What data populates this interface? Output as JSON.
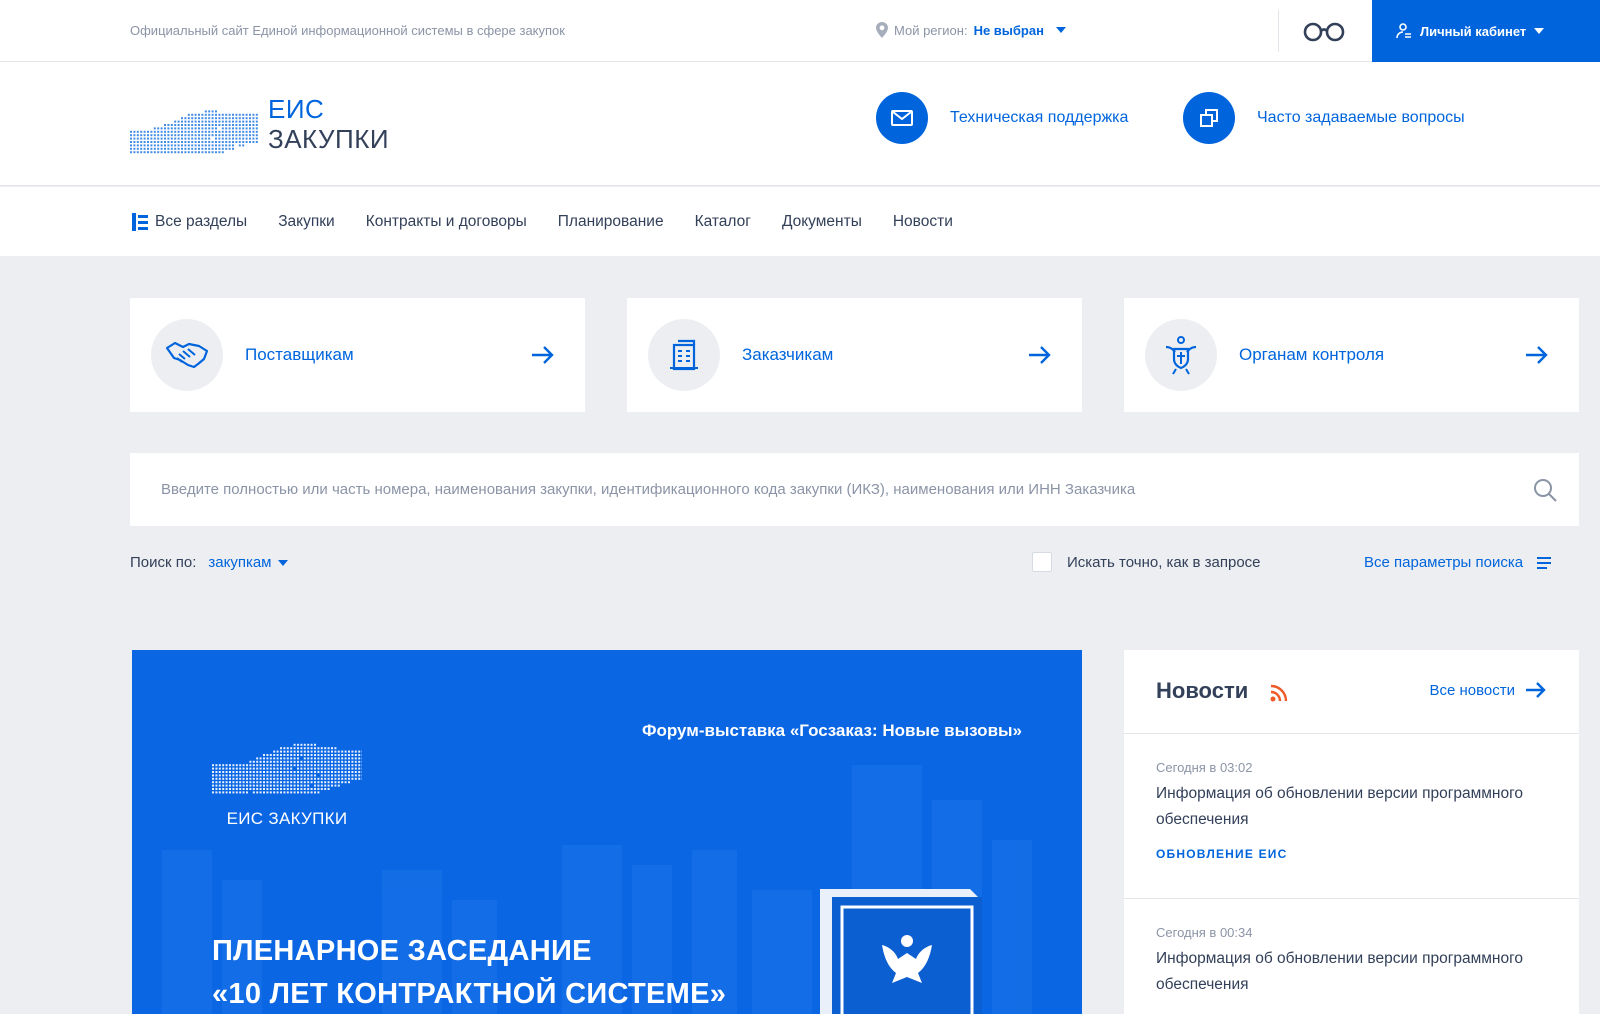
{
  "topbar": {
    "official_text": "Официальный сайт Единой информационной системы в сфере закупок",
    "region_label": "Мой регион:",
    "region_value": "Не выбран",
    "cabinet_label": "Личный кабинет"
  },
  "header": {
    "logo_line1": "ЕИС",
    "logo_line2": "ЗАКУПКИ",
    "support_label": "Техническая поддержка",
    "faq_label": "Часто задаваемые вопросы"
  },
  "nav": {
    "all_sections": "Все разделы",
    "items": [
      "Закупки",
      "Контракты и договоры",
      "Планирование",
      "Каталог",
      "Документы",
      "Новости"
    ]
  },
  "cards": [
    {
      "label": "Поставщикам",
      "icon": "handshake-icon"
    },
    {
      "label": "Заказчикам",
      "icon": "building-icon"
    },
    {
      "label": "Органам контроля",
      "icon": "emblem-icon"
    }
  ],
  "search": {
    "placeholder": "Введите полностью или часть номера, наименования закупки, идентификационного кода закупки (ИКЗ), наименования или ИНН Заказчика",
    "search_by_label": "Поиск по:",
    "search_by_value": "закупкам",
    "exact_label": "Искать точно, как в запросе",
    "all_params_label": "Все параметры поиска"
  },
  "banner": {
    "logo_text": "ЕИС ЗАКУПКИ",
    "forum_text": "Форум-выставка «Госзаказ: Новые вызовы»",
    "headline_line1": "ПЛЕНАРНОЕ ЗАСЕДАНИЕ",
    "headline_line2": "«10 ЛЕТ КОНТРАКТНОЙ СИСТЕМЕ»"
  },
  "news": {
    "title": "Новости",
    "all_label": "Все новости",
    "items": [
      {
        "time": "Сегодня в 03:02",
        "text": "Информация об обновлении версии программного обеспечения",
        "tag": "ОБНОВЛЕНИЕ ЕИС"
      },
      {
        "time": "Сегодня в 00:34",
        "text": "Информация об обновлении версии программного обеспечения",
        "tag": ""
      }
    ]
  },
  "colors": {
    "accent": "#0065dd",
    "background": "#eceef1",
    "text": "#334059",
    "muted": "#8b94a6",
    "rss": "#f05a28"
  }
}
